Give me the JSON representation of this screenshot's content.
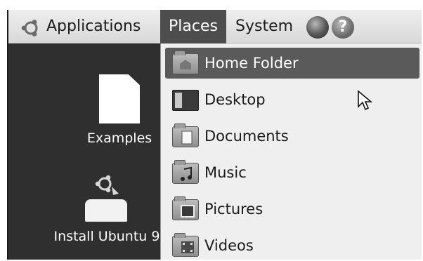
{
  "panel": {
    "applications_label": "Applications",
    "places_label": "Places",
    "system_label": "System",
    "help_glyph": "?"
  },
  "desktop": {
    "items": [
      {
        "label": "Examples",
        "icon": "document-icon"
      },
      {
        "label": "Install Ubuntu 9",
        "icon": "installer-icon"
      }
    ]
  },
  "places_menu": {
    "items": [
      {
        "label": "Home Folder",
        "icon": "home-folder-icon",
        "highlighted": true
      },
      {
        "label": "Desktop",
        "icon": "desktop-icon",
        "highlighted": false
      },
      {
        "label": "Documents",
        "icon": "documents-folder-icon",
        "highlighted": false
      },
      {
        "label": "Music",
        "icon": "music-folder-icon",
        "highlighted": false
      },
      {
        "label": "Pictures",
        "icon": "pictures-folder-icon",
        "highlighted": false
      },
      {
        "label": "Videos",
        "icon": "videos-folder-icon",
        "highlighted": false
      }
    ]
  },
  "colors": {
    "panel_bg": "#e3e3e3",
    "desktop_bg": "#2f2f2f",
    "menu_bg": "#efefef",
    "highlight": "#5a5a5a"
  }
}
